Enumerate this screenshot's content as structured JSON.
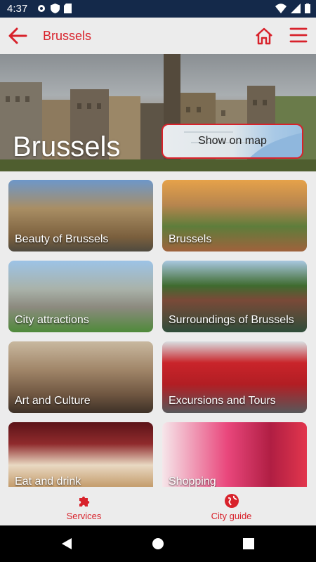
{
  "status": {
    "time": "4:37"
  },
  "appbar": {
    "title": "Brussels"
  },
  "hero": {
    "city_name": "Brussels",
    "map_button": "Show on map"
  },
  "tiles": [
    {
      "label": "Beauty of Brussels"
    },
    {
      "label": "Brussels"
    },
    {
      "label": "City attractions"
    },
    {
      "label": "Surroundings of Brussels"
    },
    {
      "label": "Art and Culture"
    },
    {
      "label": "Excursions and Tours"
    },
    {
      "label": "Eat and drink"
    },
    {
      "label": "Shopping"
    }
  ],
  "bottom_nav": {
    "services": "Services",
    "city_guide": "City guide"
  },
  "colors": {
    "accent": "#d8222b",
    "status_bar": "#14294a"
  }
}
